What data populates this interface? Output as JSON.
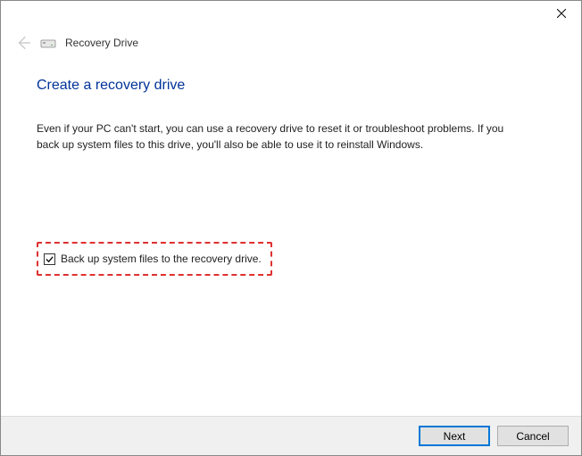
{
  "wizard": {
    "title": "Recovery Drive"
  },
  "page": {
    "heading": "Create a recovery drive",
    "description": "Even if your PC can't start, you can use a recovery drive to reset it or troubleshoot problems. If you back up system files to this drive, you'll also be able to use it to reinstall Windows."
  },
  "checkbox": {
    "label": "Back up system files to the recovery drive.",
    "checked": true
  },
  "buttons": {
    "next": "Next",
    "cancel": "Cancel"
  }
}
